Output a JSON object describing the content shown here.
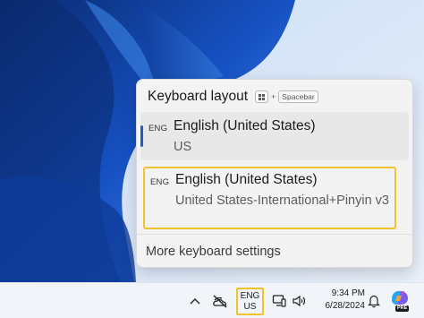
{
  "flyout": {
    "title": "Keyboard layout",
    "shortcut": {
      "win_key_icon": "windows-logo-icon",
      "plus": "+",
      "key": "Spacebar"
    },
    "layouts": [
      {
        "badge": "ENG",
        "name": "English (United States)",
        "sub": "US",
        "selected": true
      },
      {
        "badge": "ENG",
        "name": "English (United States)",
        "sub": "United States-International+Pinyin v3",
        "focused": true
      }
    ],
    "more_settings": "More keyboard settings"
  },
  "taskbar": {
    "tray_icons": [
      "chevron-up-icon",
      "network-disconnected-icon",
      "display-icon",
      "volume-icon",
      "notification-bell-icon",
      "copilot-icon"
    ],
    "lang_top": "ENG",
    "lang_bottom": "US",
    "time": "9:34 PM",
    "date": "6/28/2024",
    "copilot_badge": "PRE"
  },
  "colors": {
    "accent": "#1f5fbf",
    "focus_ring": "#f0c22c",
    "flyout_bg": "#f3f3f3",
    "taskbar_bg": "#f1f4f9"
  }
}
